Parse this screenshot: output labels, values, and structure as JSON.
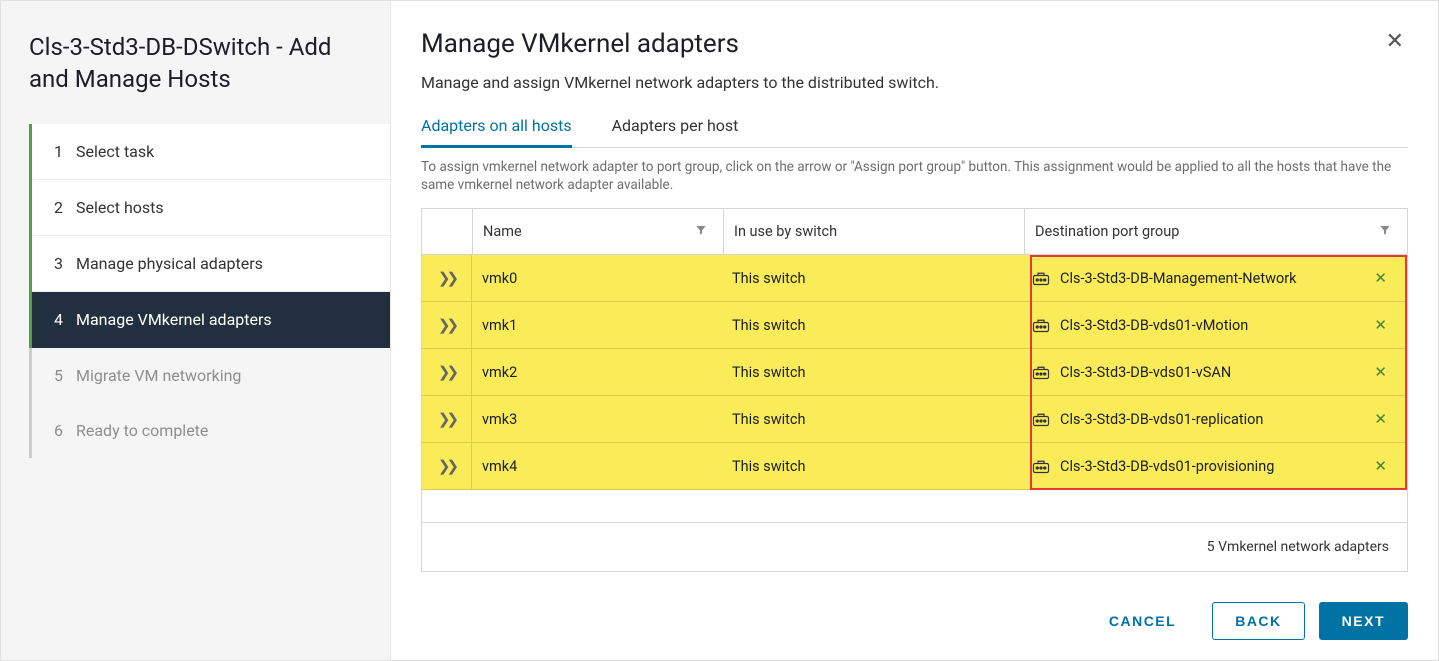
{
  "sidebar": {
    "title": "Cls-3-Std3-DB-DSwitch - Add and Manage Hosts",
    "steps": [
      {
        "num": "1",
        "label": "Select task"
      },
      {
        "num": "2",
        "label": "Select hosts"
      },
      {
        "num": "3",
        "label": "Manage physical adapters"
      },
      {
        "num": "4",
        "label": "Manage VMkernel adapters"
      },
      {
        "num": "5",
        "label": "Migrate VM networking"
      },
      {
        "num": "6",
        "label": "Ready to complete"
      }
    ]
  },
  "main": {
    "title": "Manage VMkernel adapters",
    "subtitle": "Manage and assign VMkernel network adapters to the distributed switch.",
    "tabs": [
      {
        "label": "Adapters on all hosts"
      },
      {
        "label": "Adapters per host"
      }
    ],
    "help": "To assign vmkernel network adapter to port group, click on the arrow or \"Assign port group\" button. This assignment would be applied to all the hosts that have the same vmkernel network adapter available.",
    "columns": {
      "name": "Name",
      "switch": "In use by switch",
      "dest": "Destination port group"
    },
    "rows": [
      {
        "name": "vmk0",
        "switch": "This switch",
        "dest": "Cls-3-Std3-DB-Management-Network"
      },
      {
        "name": "vmk1",
        "switch": "This switch",
        "dest": "Cls-3-Std3-DB-vds01-vMotion"
      },
      {
        "name": "vmk2",
        "switch": "This switch",
        "dest": "Cls-3-Std3-DB-vds01-vSAN"
      },
      {
        "name": "vmk3",
        "switch": "This switch",
        "dest": "Cls-3-Std3-DB-vds01-replication"
      },
      {
        "name": "vmk4",
        "switch": "This switch",
        "dest": "Cls-3-Std3-DB-vds01-provisioning"
      }
    ],
    "footer": "5 Vmkernel network adapters",
    "buttons": {
      "cancel": "CANCEL",
      "back": "BACK",
      "next": "NEXT"
    }
  }
}
